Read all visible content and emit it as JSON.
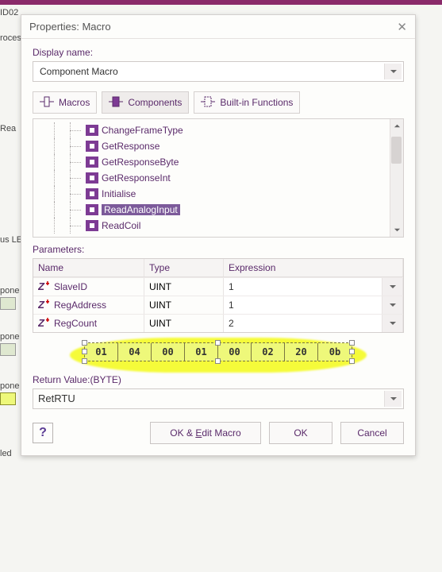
{
  "bg": {
    "frag1": "ID02",
    "frag2": "roces",
    "frag3": "Rea",
    "frag4": "us LE",
    "frag5": "pone",
    "frag6": "pone",
    "frag7": "pone",
    "frag8": "led"
  },
  "dialog": {
    "title": "Properties: Macro",
    "display_name_label": "Display name:",
    "display_name_value": "Component Macro",
    "tabs": {
      "macros": "Macros",
      "components": "Components",
      "builtin": "Built-in Functions"
    },
    "tree": [
      {
        "label": "ChangeFrameType",
        "selected": false
      },
      {
        "label": "GetResponse",
        "selected": false
      },
      {
        "label": "GetResponseByte",
        "selected": false
      },
      {
        "label": "GetResponseInt",
        "selected": false
      },
      {
        "label": "Initialise",
        "selected": false
      },
      {
        "label": "ReadAnalogInput",
        "selected": true
      },
      {
        "label": "ReadCoil",
        "selected": false
      }
    ],
    "parameters_label": "Parameters:",
    "grid": {
      "headers": {
        "name": "Name",
        "type": "Type",
        "expr": "Expression"
      },
      "rows": [
        {
          "name": "SlaveID",
          "type": "UINT",
          "expr": "1"
        },
        {
          "name": "RegAddress",
          "type": "UINT",
          "expr": "1"
        },
        {
          "name": "RegCount",
          "type": "UINT",
          "expr": "2"
        }
      ]
    },
    "bytes": [
      "01",
      "04",
      "00",
      "01",
      "00",
      "02",
      "20",
      "0b"
    ],
    "return_label": "Return Value:(BYTE)",
    "return_value": "RetRTU",
    "buttons": {
      "okedit_pre": "OK & ",
      "okedit_u": "E",
      "okedit_post": "dit Macro",
      "ok": "OK",
      "cancel": "Cancel"
    }
  }
}
